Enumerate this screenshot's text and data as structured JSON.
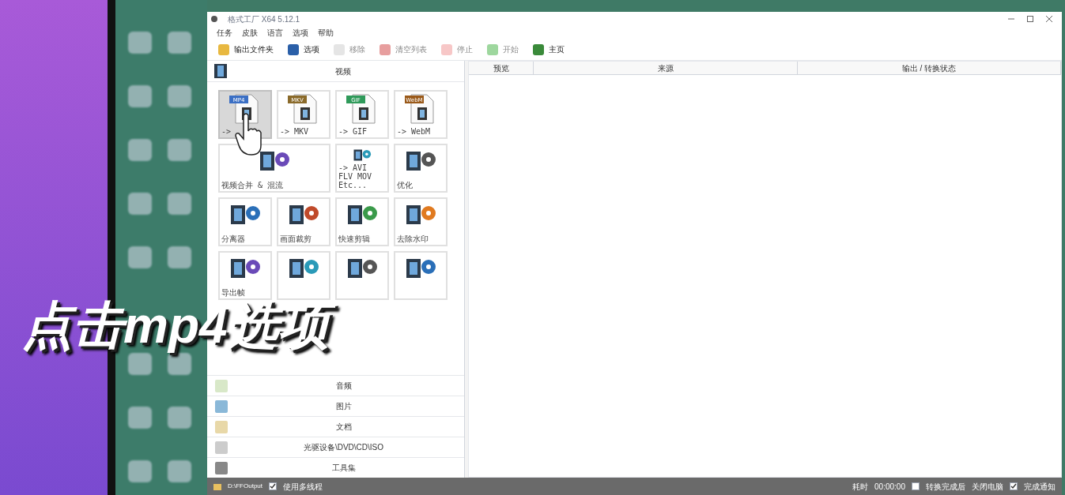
{
  "caption": {
    "text": "点击mp4选项"
  },
  "window": {
    "title": "格式工厂 X64 5.12.1"
  },
  "menu": [
    "任务",
    "皮肤",
    "语言",
    "选项",
    "帮助"
  ],
  "toolbar": [
    {
      "label": "输出文件夹",
      "disabled": false
    },
    {
      "label": "选项",
      "disabled": false
    },
    {
      "label": "移除",
      "disabled": true
    },
    {
      "label": "清空列表",
      "disabled": true
    },
    {
      "label": "停止",
      "disabled": true
    },
    {
      "label": "开始",
      "disabled": true
    },
    {
      "label": "主页",
      "disabled": false
    }
  ],
  "video_section": {
    "title": "视频",
    "tiles": [
      {
        "kind": "format",
        "badge": "MP4",
        "color": "#3b6fc4",
        "label": "->",
        "selected": true,
        "wide": false
      },
      {
        "kind": "format",
        "badge": "MKV",
        "color": "#8a6a2a",
        "label": "-> MKV",
        "selected": false,
        "wide": false
      },
      {
        "kind": "format",
        "badge": "GIF",
        "color": "#2f9a5a",
        "label": "-> GIF",
        "selected": false,
        "wide": false
      },
      {
        "kind": "format",
        "badge": "WebM",
        "color": "#9a5a1a",
        "label": "-> WebM",
        "selected": false,
        "wide": false
      },
      {
        "kind": "tool",
        "label": "视频合并 & 混流",
        "selected": false,
        "wide": true
      },
      {
        "kind": "tool",
        "label": "-> AVI FLV MOV Etc...",
        "selected": false,
        "wide": false
      },
      {
        "kind": "tool",
        "label": "优化",
        "selected": false,
        "wide": false
      },
      {
        "kind": "tool",
        "label": "分离器",
        "selected": false,
        "wide": false
      },
      {
        "kind": "tool",
        "label": "画面裁剪",
        "selected": false,
        "wide": false
      },
      {
        "kind": "tool",
        "label": "快速剪辑",
        "selected": false,
        "wide": false
      },
      {
        "kind": "tool",
        "label": "去除水印",
        "selected": false,
        "wide": false
      },
      {
        "kind": "tool",
        "label": "导出帧",
        "selected": false,
        "wide": false
      },
      {
        "kind": "tool",
        "selected": false,
        "wide": false
      },
      {
        "kind": "tool",
        "selected": false,
        "wide": false
      },
      {
        "kind": "tool",
        "selected": false,
        "wide": false
      }
    ]
  },
  "sections": [
    "音频",
    "图片",
    "文档",
    "光驱设备\\DVD\\CD\\ISO",
    "工具集"
  ],
  "table": {
    "columns": [
      "预览",
      "来源",
      "输出 / 转换状态"
    ]
  },
  "status_bar": {
    "folder": "D:\\FFOutput",
    "multithread": {
      "label": "使用多线程",
      "checked": true
    },
    "elapsed_label": "耗时",
    "elapsed": "00:00:00",
    "shutdown": {
      "label": "转换完成后",
      "checked": false
    },
    "shutdown_action": "关闭电脑",
    "notify": {
      "label": "完成通知",
      "checked": true
    }
  }
}
